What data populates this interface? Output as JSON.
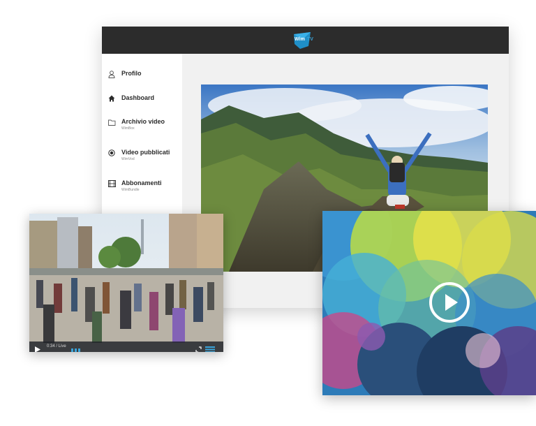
{
  "app": {
    "logo_text": "Wim",
    "logo_suffix": "TV",
    "colors": {
      "topbar": "#2c2c2c",
      "accent": "#2e9fd6",
      "logo_mark": "#1f8fc8"
    }
  },
  "sidebar": {
    "items": [
      {
        "label": "Profilo",
        "sub": "",
        "icon": "user-icon"
      },
      {
        "label": "Dashboard",
        "sub": "",
        "icon": "home-icon"
      },
      {
        "label": "Archivio video",
        "sub": "WimBox",
        "icon": "folder-icon"
      },
      {
        "label": "Video pubblicati",
        "sub": "WimVod",
        "icon": "record-icon"
      },
      {
        "label": "Abbonamenti",
        "sub": "WimBundle",
        "icon": "film-icon"
      }
    ]
  },
  "player": {
    "time": "0:34 / Live",
    "play_icon": "play-icon",
    "expand_icon": "expand-icon",
    "menu_icon": "menu-icon"
  },
  "video2": {
    "play_icon": "play-circle-icon"
  }
}
